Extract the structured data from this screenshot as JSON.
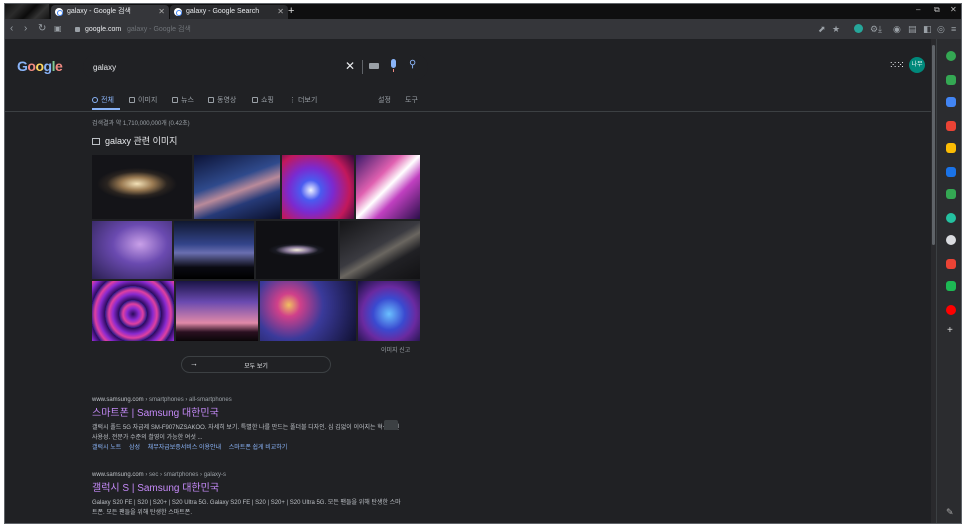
{
  "browser": {
    "tabs": [
      {
        "title": "galaxy - Google 검색",
        "active": true
      },
      {
        "title": "galaxy - Google Search",
        "active": false
      }
    ],
    "new_tab": "+",
    "window_controls": [
      "–",
      "⧉",
      "✕"
    ],
    "address": {
      "host": "google.com",
      "rest": "galaxy - Google 검색"
    }
  },
  "search": {
    "query": "galaxy",
    "clear": "✕"
  },
  "account": {
    "initials": "나무"
  },
  "nav_tabs": [
    {
      "label": "전체",
      "active": true
    },
    {
      "label": "이미지"
    },
    {
      "label": "뉴스"
    },
    {
      "label": "동영상"
    },
    {
      "label": "쇼핑"
    },
    {
      "label": "더보기"
    }
  ],
  "settings_label": "설정",
  "tools_label": "도구",
  "stats": "검색결과 약 1,710,000,000개 (0.42초)",
  "images_heading": "galaxy 관련 이미지",
  "image_tiles": [
    {
      "color": "#7a6b58"
    },
    {
      "color": "#3d4f8a"
    },
    {
      "color": "#3a1c7a"
    },
    {
      "color": "#a43da0"
    },
    {
      "color": "#6d5aa8"
    },
    {
      "color": "#1e2a52"
    },
    {
      "color": "#1e1f2a"
    },
    {
      "color": "#2c2b30"
    },
    {
      "color": "#5b2a9a"
    },
    {
      "color": "#8a3d8f"
    },
    {
      "color": "#2e2f6a"
    },
    {
      "color": "#1d2f6a"
    }
  ],
  "report_images": "이미지 신고",
  "view_all": "모두 보기",
  "results": [
    {
      "host": "www.samsung.com",
      "path": " › smartphones › all-smartphones",
      "title": "스마트폰 | Samsung 대한민국",
      "snippet": "갤럭시 폴드 5G 자급제 SM-F907NZSAKOO. 자세히 보기. 특별한 나를 만드는 폴더블 디자인. 심 김없이 이어지는 혁신적인 사용성. 전문가 수준의 촬영이 가능한 여섯 ...",
      "links": [
        "갤럭시 노트",
        "삼성",
        "채무자급보증서비스 이용안내",
        "스마트폰 쉽게 비교하기"
      ]
    },
    {
      "host": "www.samsung.com",
      "path": " › sec › smartphones › galaxy-s",
      "title": "갤럭시 S | Samsung 대한민국",
      "snippet": "Galaxy S20 FE | S20 | S20+ | S20 Ultra 5G. Galaxy S20 FE | S20 | S20+ | S20 Ultra 5G. 모든 팬들을 위해 탄생한 스마트폰. 모든 팬들을 위해 탄생한 스마트폰."
    }
  ],
  "side_panel": [
    {
      "color": "#34a853"
    },
    {
      "color": "#34a853"
    },
    {
      "color": "#4285f4"
    },
    {
      "color": "#ea4335"
    },
    {
      "color": "#fbbc04"
    },
    {
      "color": "#1a73e8"
    },
    {
      "color": "#34a853"
    },
    {
      "color": "#24c1a0"
    },
    {
      "color": "#dadce0"
    },
    {
      "color": "#ea4335"
    },
    {
      "color": "#1db954"
    },
    {
      "color": "#ff0000"
    }
  ],
  "side_add": "+"
}
